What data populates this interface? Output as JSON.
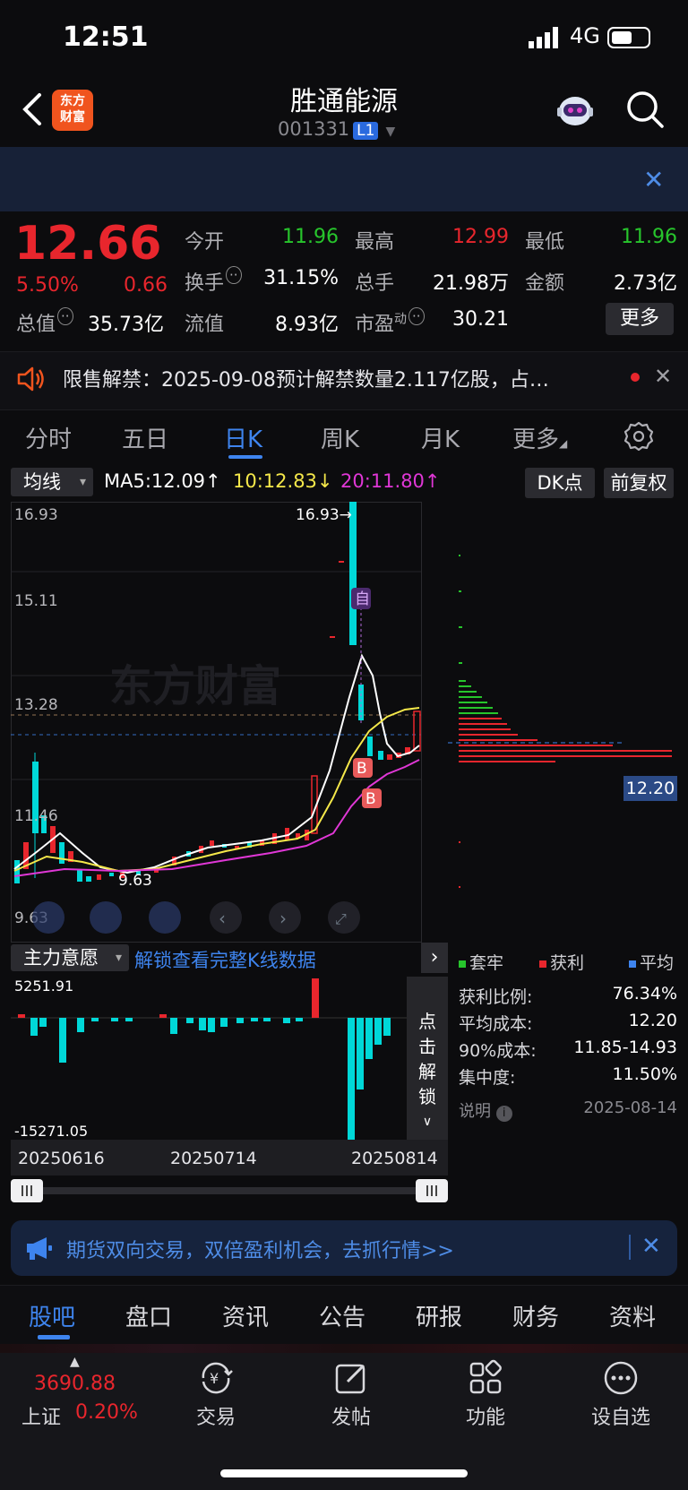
{
  "status": {
    "time": "12:51",
    "network": "4G"
  },
  "header": {
    "logo_text_1": "东方",
    "logo_text_2": "财富",
    "stock_name": "胜通能源",
    "stock_code": "001331",
    "level": "L1"
  },
  "quote": {
    "price": "12.66",
    "change_pct": "5.50%",
    "change_amt": "0.66",
    "open_label": "今开",
    "open": "11.96",
    "high_label": "最高",
    "high": "12.99",
    "low_label": "最低",
    "low": "11.96",
    "turnover_label": "换手",
    "turnover": "31.15%",
    "volume_label": "总手",
    "volume": "21.98万",
    "amount_label": "金额",
    "amount": "2.73亿",
    "mcap_label": "总值",
    "mcap": "35.73亿",
    "float_label": "流值",
    "float": "8.93亿",
    "pe_label": "市盈",
    "pe_sup": "动",
    "pe": "30.21",
    "more": "更多"
  },
  "notice": {
    "text": "限售解禁：2025-09-08预计解禁数量2.117亿股，占…"
  },
  "period_tabs": [
    "分时",
    "五日",
    "日K",
    "周K",
    "月K",
    "更多"
  ],
  "active_period": "日K",
  "ma": {
    "select": "均线",
    "ma5": "MA5:12.09↑",
    "ma10": "10:12.83↓",
    "ma20": "20:11.80↑",
    "dk": "DK点",
    "fq": "前复权"
  },
  "kchart": {
    "y_labels": [
      "16.93",
      "15.11",
      "13.28",
      "11.46",
      "9.63"
    ],
    "max_label": "16.93→",
    "min_label": "9.63",
    "marker_zi": "自",
    "marker_b": "B",
    "watermark": "东方财富",
    "chip_price": "12.20"
  },
  "indicator": {
    "select": "主力意愿",
    "unlock": "解锁查看完整K线数据",
    "max": "5251.91",
    "min": "-15271.05",
    "side_unlock": "点击解锁",
    "dates": [
      "20250616",
      "20250714",
      "20250814"
    ]
  },
  "chip_stats": {
    "legend": [
      {
        "label": "套牢",
        "color": "#27c52c"
      },
      {
        "label": "获利",
        "color": "#e8262d"
      },
      {
        "label": "平均",
        "color": "#3e84ee"
      }
    ],
    "rows": [
      {
        "label": "获利比例:",
        "value": "76.34%"
      },
      {
        "label": "平均成本:",
        "value": "12.20"
      },
      {
        "label": "90%成本:",
        "value": "11.85-14.93"
      },
      {
        "label": "集中度:",
        "value": "11.50%"
      }
    ],
    "note_label": "说明",
    "note_date": "2025-08-14"
  },
  "ad": {
    "text": "期货双向交易，双倍盈利机会，去抓行情>>"
  },
  "bottom_tabs": [
    "股吧",
    "盘口",
    "资讯",
    "公告",
    "研报",
    "财务",
    "资料"
  ],
  "bottom_nav": {
    "index_value": "3690.88",
    "index_name": "上证",
    "index_pct": "0.20%",
    "items": [
      "交易",
      "发帖",
      "功能",
      "设自选"
    ]
  }
}
